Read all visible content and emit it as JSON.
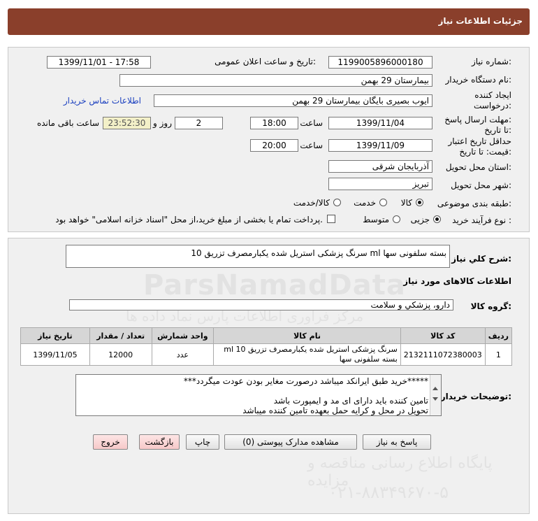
{
  "header": {
    "title": "جزئیات اطلاعات نیاز"
  },
  "form": {
    "need_number_label": "شماره نیاز:",
    "need_number": "1199005896000180",
    "announce_label": "تاریخ و ساعت اعلان عمومی:",
    "announce_value": "1399/11/01 - 17:58",
    "buyer_org_label": "نام دستگاه خریدار:",
    "buyer_org": "بیمارستان 29 بهمن",
    "creator_label_1": "ایجاد کننده",
    "creator_label_2": "درخواست:",
    "creator": "ایوب بصیری  بایگان بیمارستان 29 بهمن",
    "contact_link": "اطلاعات تماس خریدار",
    "reply_deadline_label_1": "مهلت ارسال پاسخ:",
    "reply_deadline_label_2": "تا تاریخ:",
    "reply_date": "1399/11/04",
    "time_label": "ساعت",
    "reply_time": "18:00",
    "days_value": "2",
    "days_label": "روز و",
    "remaining_time": "23:52:30",
    "remaining_label": "ساعت باقی مانده",
    "price_validity_label_1": "حداقل تاریخ اعتبار",
    "price_validity_label_2": "قیمت: تا تاریخ:",
    "validity_date": "1399/11/09",
    "validity_time_label": "ساعت",
    "validity_time": "20:00",
    "province_label": "استان محل تحویل:",
    "province": "آذربایجان شرقی",
    "city_label": "شهر محل تحویل:",
    "city": "تبریز",
    "category_label": "طبقه بندی موضوعی:",
    "category_options": [
      "کالا",
      "خدمت",
      "کالا/خدمت"
    ],
    "process_label": "نوع فرآیند خرید :",
    "process_options": [
      "جزیی",
      "متوسط"
    ],
    "payment_note": "پرداخت تمام یا بخشی از مبلغ خرید،از محل \"اسناد خزانه اسلامی\" خواهد بود."
  },
  "summary": {
    "label": "شرح کلي نياز:",
    "value": "سرنگ پزشکی استریل شده یکبارمصرف تزریق 10 ml بسته سلفونی سها"
  },
  "goods": {
    "section_title": "اطلاعات کالاهای مورد نیاز",
    "group_label": "گروه کالا:",
    "group_value": "دارو، پزشکي و سلامت",
    "columns": [
      "ردیف",
      "کد کالا",
      "نام کالا",
      "واحد شمارش",
      "تعداد / مقدار",
      "تاریخ نیاز"
    ],
    "rows": [
      {
        "row": "1",
        "code": "2132111072380003",
        "name": "سرنگ پزشکی استریل شده یکبارمصرف تزریق 10 ml بسته سلفونی سها",
        "unit": "عدد",
        "qty": "12000",
        "date": "1399/11/05"
      }
    ]
  },
  "buyer_notes": {
    "label": "توضیحات خریدار:",
    "lines": [
      "*****خرید طبق ایرانکد میباشد درصورت مغایر بودن عودت میگردد***",
      "",
      "تامین کننده باید دارای ای مد و ایمپورت باشد",
      "تحویل در محل و کرایه حمل بعهده تامین کننده میباشد"
    ]
  },
  "buttons": {
    "reply": "پاسخ به نیاز",
    "attachments": "مشاهده مدارک پیوستی (0)",
    "print": "چاپ",
    "back": "بازگشت",
    "exit": "خروج"
  },
  "watermark": {
    "brand": "ParsNamadData",
    "line1": "مرکز فراوری اطلاعات پارس نماد داده ها",
    "line2": "پایگاه اطلاع رسانی مناقصه و مزایده",
    "phone": "۰۲۱-۸۸۳۴۹۶۷۰-۵"
  }
}
